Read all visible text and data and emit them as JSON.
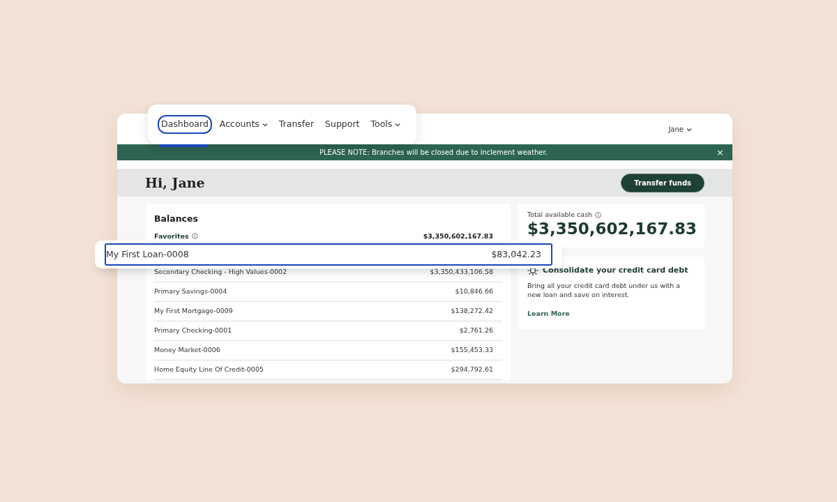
{
  "nav": {
    "items": [
      {
        "label": "Dashboard",
        "selected": true,
        "dropdown": false
      },
      {
        "label": "Accounts",
        "selected": false,
        "dropdown": true
      },
      {
        "label": "Transfer",
        "selected": false,
        "dropdown": false
      },
      {
        "label": "Support",
        "selected": false,
        "dropdown": false
      },
      {
        "label": "Tools",
        "selected": false,
        "dropdown": true
      }
    ],
    "user": {
      "label": "Jane",
      "dropdown": true
    }
  },
  "banner": {
    "text": "PLEASE NOTE: Branches will be closed due to inclement weather.",
    "close": "×"
  },
  "greeting": {
    "title": "Hi, Jane",
    "button": "Transfer funds"
  },
  "balances": {
    "title": "Balances",
    "favorites_label": "Favorites",
    "favorites_total": "$3,350,602,167.83",
    "highlighted": {
      "name": "My First Loan-0008",
      "amount": "$83,042.23"
    },
    "rows": [
      {
        "name": "Secondary Checking - High Values-0002",
        "amount": "$3,350,433,106.58"
      },
      {
        "name": "Primary Savings-0004",
        "amount": "$10,846.66"
      },
      {
        "name": "My First Mortgage-0009",
        "amount": "$138,272.42"
      },
      {
        "name": "Primary Checking-0001",
        "amount": "$2,761.26"
      },
      {
        "name": "Money Market-0006",
        "amount": "$155,453.33"
      },
      {
        "name": "Home Equity Line Of Credit-0005",
        "amount": "$294,792.61"
      }
    ]
  },
  "cash": {
    "label": "Total available cash",
    "amount": "$3,350,602,167.83"
  },
  "promo": {
    "title": "Consolidate your credit card debt",
    "text": "Bring all your credit card debt under us with a new loan and save on interest.",
    "link": "Learn More"
  }
}
